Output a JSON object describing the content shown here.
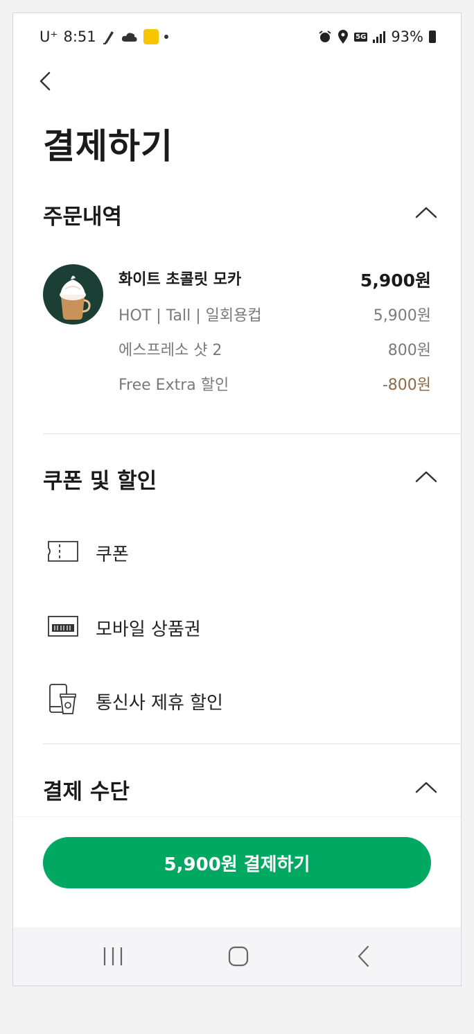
{
  "status_bar": {
    "carrier": "U⁺",
    "time": "8:51",
    "network": "5G",
    "battery": "93%"
  },
  "header": {
    "title": "결제하기"
  },
  "order_section": {
    "title": "주문내역",
    "item": {
      "name": "화이트 초콜릿 모카",
      "price": "5,900원",
      "options": [
        {
          "label": "HOT | Tall | 일회용컵",
          "price": "5,900원"
        },
        {
          "label": "에스프레소 샷 2",
          "price": "800원"
        },
        {
          "label": "Free Extra 할인",
          "price": "-800원"
        }
      ]
    }
  },
  "discount_section": {
    "title": "쿠폰 및 할인",
    "items": [
      {
        "label": "쿠폰",
        "icon": "ticket-icon"
      },
      {
        "label": "모바일 상품권",
        "icon": "gift-card-icon"
      },
      {
        "label": "통신사 제휴 할인",
        "icon": "phone-cup-icon"
      }
    ]
  },
  "payment_section": {
    "title": "결제 수단"
  },
  "pay_button": {
    "label": "5,900원 결제하기"
  },
  "colors": {
    "accent": "#00a862",
    "discount": "#8b6c48",
    "product_bg": "#1c3f35"
  }
}
